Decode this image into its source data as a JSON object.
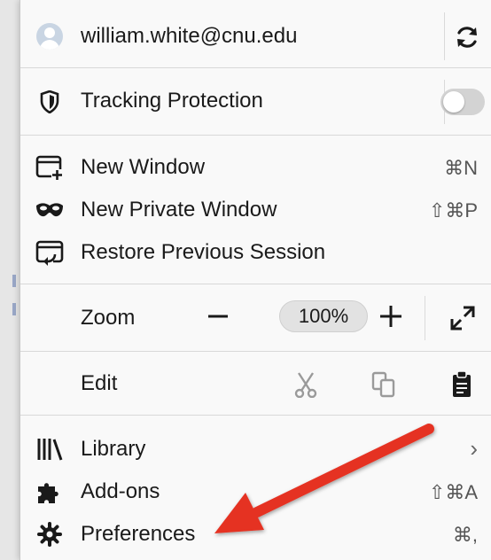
{
  "account": {
    "email": "william.white@cnu.edu",
    "avatar_icon": "avatar-icon",
    "sync_icon": "sync-icon"
  },
  "tracking": {
    "label": "Tracking Protection",
    "icon": "shield-icon",
    "enabled": false
  },
  "window_items": [
    {
      "label": "New Window",
      "shortcut": "⌘N",
      "icon": "new-window-icon"
    },
    {
      "label": "New Private Window",
      "shortcut": "⇧⌘P",
      "icon": "private-mask-icon"
    },
    {
      "label": "Restore Previous Session",
      "shortcut": "",
      "icon": "restore-session-icon"
    }
  ],
  "zoom": {
    "label": "Zoom",
    "value": "100%",
    "minus": "−",
    "plus": "+"
  },
  "edit": {
    "label": "Edit"
  },
  "bottom_items": [
    {
      "label": "Library",
      "shortcut": "›",
      "icon": "library-icon"
    },
    {
      "label": "Add-ons",
      "shortcut": "⇧⌘A",
      "icon": "puzzle-icon"
    },
    {
      "label": "Preferences",
      "shortcut": "⌘,",
      "icon": "gear-icon"
    }
  ],
  "colors": {
    "annotation_arrow": "#e53224",
    "toggle_off": "#d3d3d3"
  }
}
